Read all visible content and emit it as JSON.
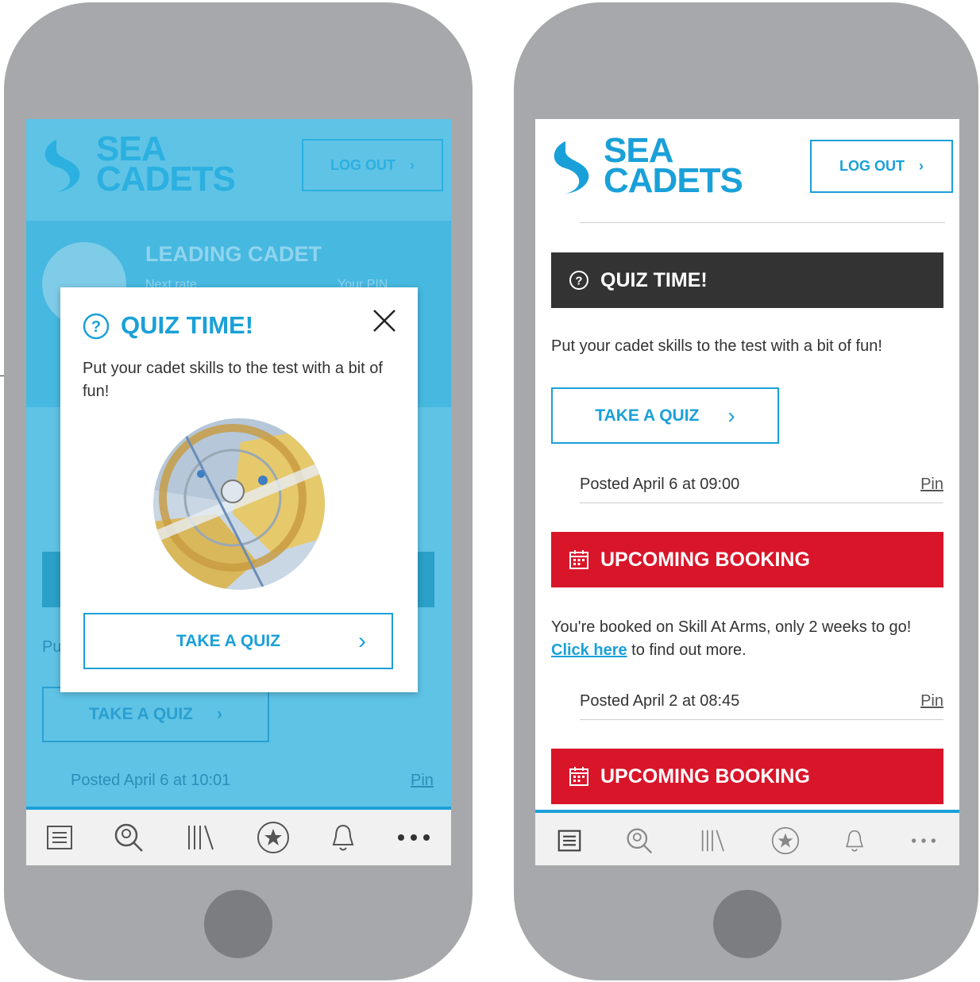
{
  "colors": {
    "accent": "#1aa0d8",
    "dark_banner": "#333333",
    "red_banner": "#d9152a",
    "phone": "#a7a8ab",
    "overlay": "#5fc3e6"
  },
  "left": {
    "logo_line1": "SEA",
    "logo_line2": "CADETS",
    "logout": "LOG OUT",
    "profile_rank": "LEADING CADET",
    "profile_next": "Next rate",
    "profile_pin": "Your PIN",
    "bg_text": "Pu",
    "bg_take_quiz": "TAKE A QUIZ",
    "bg_posted": "Posted April 6 at 10:01",
    "bg_pin": "Pin",
    "modal": {
      "title": "QUIZ TIME!",
      "body": "Put your cadet skills to the test with a bit of fun!",
      "button": "TAKE A QUIZ"
    }
  },
  "right": {
    "logo_line1": "SEA",
    "logo_line2": "CADETS",
    "logout": "LOG OUT",
    "quiz_banner": "QUIZ TIME!",
    "quiz_body": "Put your cadet skills to the test with a bit of fun!",
    "take_quiz": "TAKE A QUIZ",
    "posted1": "Posted April 6 at 09:00",
    "pin1": "Pin",
    "booking_banner1": "UPCOMING BOOKING",
    "booking_body": "You're booked on Skill At Arms, only 2 weeks to go!",
    "click_here": "Click here",
    "find_out": " to find out more.",
    "posted2": "Posted April 2 at 08:45",
    "pin2": "Pin",
    "booking_banner2": "UPCOMING BOOKING"
  },
  "nav_icons": [
    "news-list-icon",
    "search-icon",
    "library-icon",
    "star-icon",
    "bell-icon",
    "more-icon"
  ]
}
